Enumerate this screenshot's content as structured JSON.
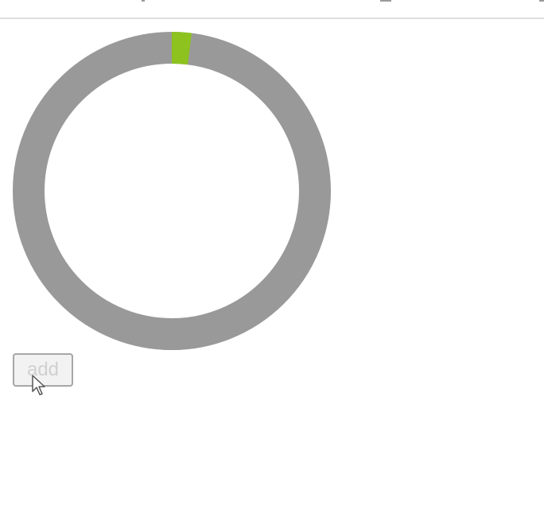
{
  "progress_ring": {
    "progress_fraction": 0.02,
    "track_color": "#999999",
    "fill_color": "#8dc21f"
  },
  "add_button": {
    "label": "add"
  },
  "cursor": {
    "icon": "arrow-cursor-icon"
  }
}
